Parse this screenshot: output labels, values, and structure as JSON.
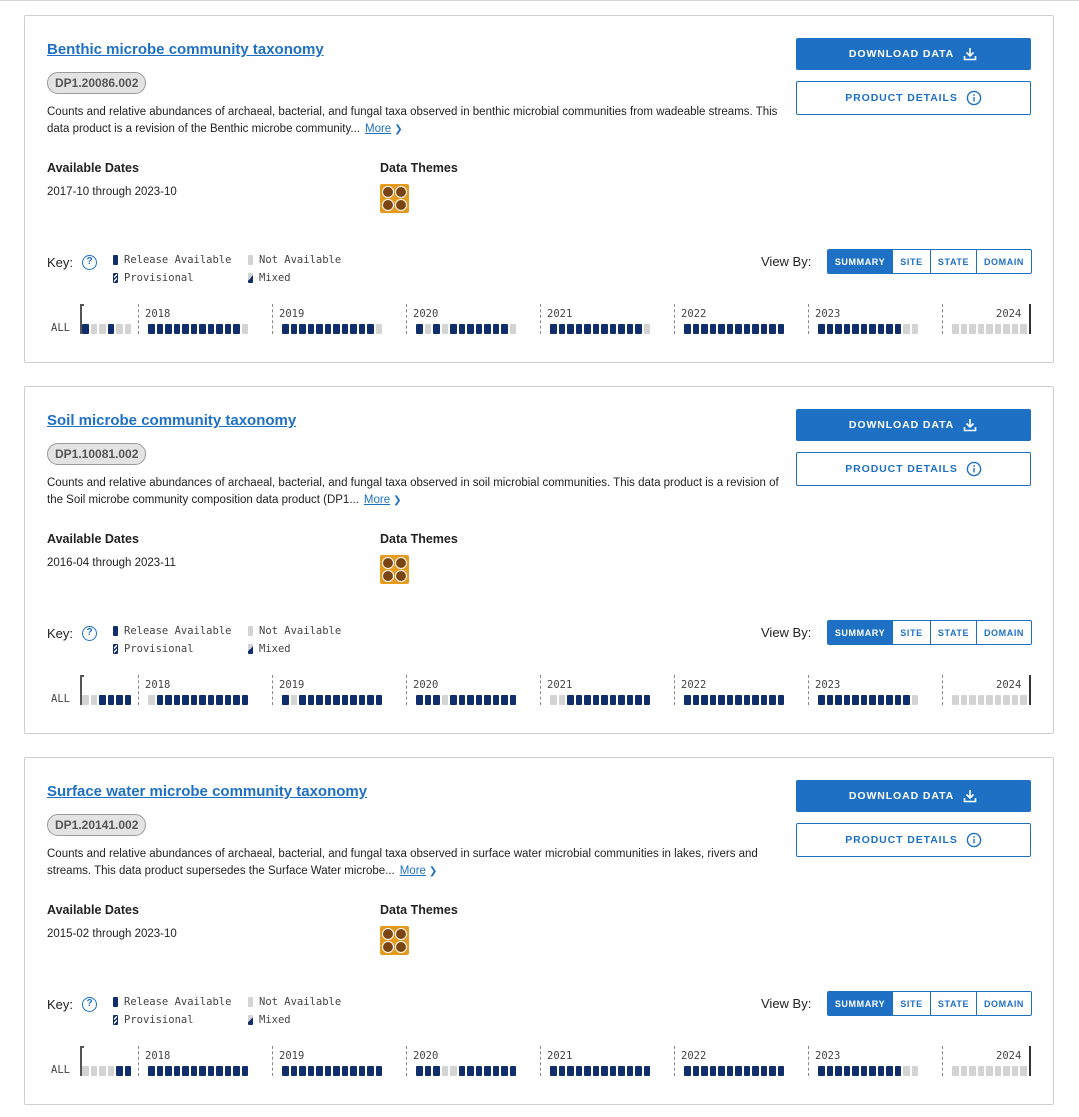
{
  "labels": {
    "available_dates": "Available Dates",
    "data_themes": "Data Themes",
    "download": "DOWNLOAD DATA",
    "details": "PRODUCT DETAILS",
    "more": "More",
    "key": "Key:",
    "help": "?",
    "view_by": "View By:",
    "legend": {
      "release": "Release Available",
      "not_available": "Not Available",
      "provisional": "Provisional",
      "mixed": "Mixed"
    },
    "view_options": [
      "SUMMARY",
      "SITE",
      "STATE",
      "DOMAIN"
    ],
    "selected_view": "SUMMARY",
    "timeline_row": "ALL",
    "years": [
      "2018",
      "2019",
      "2020",
      "2021",
      "2022",
      "2023",
      "2024"
    ]
  },
  "colors": {
    "accent": "#1e70c5",
    "release": "#0f2e6b",
    "not_available": "#d3d3d3",
    "theme_bg": "#e49a1e"
  },
  "products": [
    {
      "title": "Benthic microbe community taxonomy",
      "code": "DP1.20086.002",
      "description": "Counts and relative abundances of archaeal, bacterial, and fungal taxa observed in benthic microbial communities from wadeable streams. This data product is a revision of the Benthic microbe community...",
      "dates": "2017-10 through 2023-10",
      "theme_icon": "organisms-theme-icon",
      "timeline": [
        "RNNRNN",
        "RRRRRRRRRRRN",
        "RRRRRRRRRRRN",
        "RNRNRRRRRRRN",
        "RRRRRRRRRRRN",
        "RRRRRRRRRRRR",
        "RRRRRRRRRRNN",
        "NNNNNNNNN"
      ]
    },
    {
      "title": "Soil microbe community taxonomy",
      "code": "DP1.10081.002",
      "description": "Counts and relative abundances of archaeal, bacterial, and fungal taxa observed in soil microbial communities. This data product is a revision of the Soil microbe community composition data product (DP1...",
      "dates": "2016-04 through 2023-11",
      "theme_icon": "organisms-theme-icon",
      "timeline": [
        "NNRRRR",
        "NRRRRRRRRRRR",
        "RNRRRRRRRRRR",
        "RRRNRRRRRRRR",
        "NNRRRRRRRRRR",
        "RRRRRRRRRRRR",
        "RRRRRRRRRRRN",
        "NNNNNNNNN"
      ]
    },
    {
      "title": "Surface water microbe community taxonomy",
      "code": "DP1.20141.002",
      "description": "Counts and relative abundances of archaeal, bacterial, and fungal taxa observed in surface water microbial communities in lakes, rivers and streams. This data product supersedes the Surface Water microbe...",
      "dates": "2015-02 through 2023-10",
      "theme_icon": "organisms-theme-icon",
      "timeline": [
        "NNNNRR",
        "RRRRRRRRRRRR",
        "RRRRRRRRRRRR",
        "RRRNNRRRRRRR",
        "RRRRRRRRRRRR",
        "RRRRRRRRRRRR",
        "RRRRRRRRRRNN",
        "NNNNNNNNN"
      ]
    }
  ]
}
